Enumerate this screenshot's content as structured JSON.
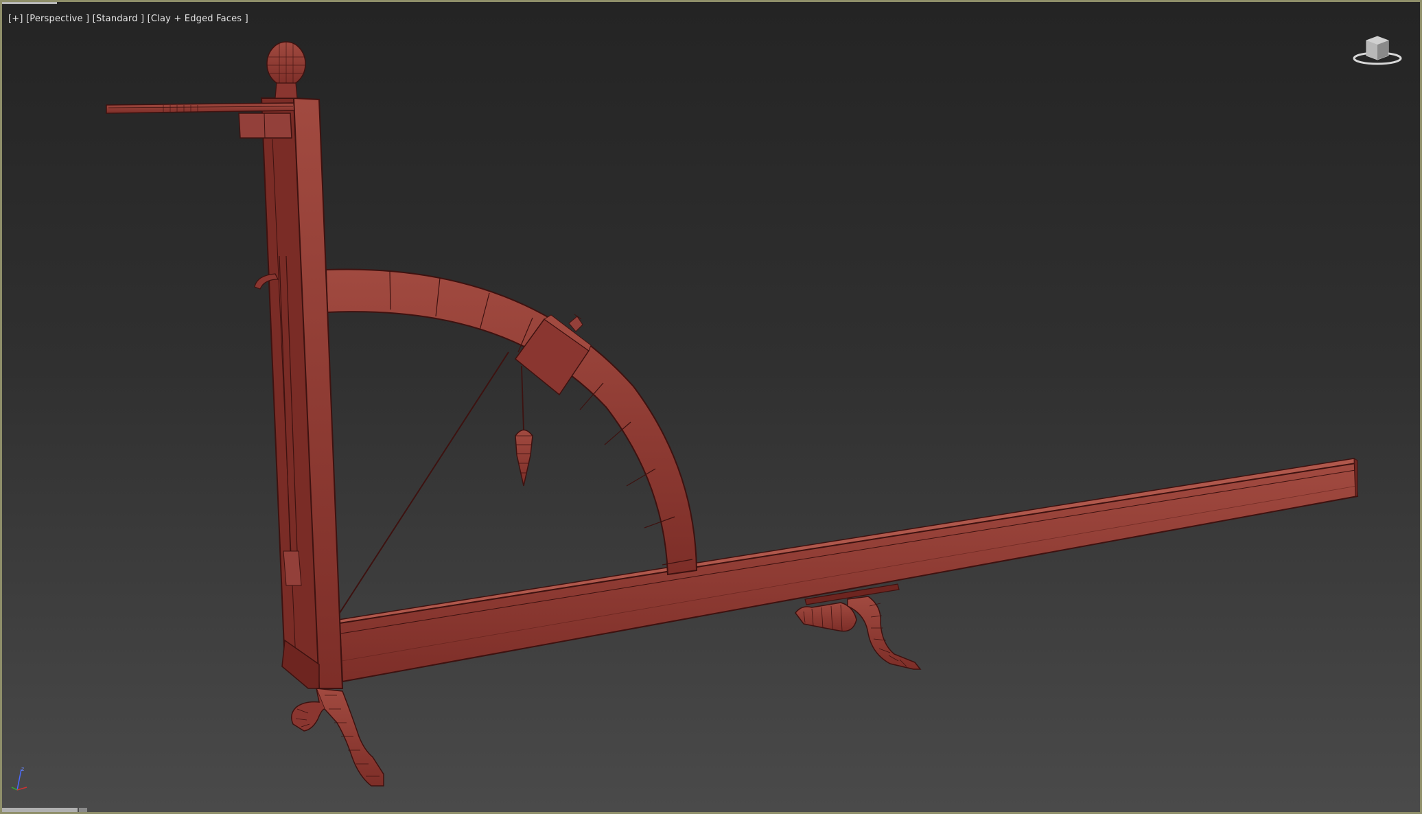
{
  "viewport": {
    "label": "[+] [Perspective ] [Standard ] [Clay + Edged Faces ]",
    "border_color": "#8f8f6a",
    "model_color": "#8e3a32",
    "model_edge_color": "#3d1210"
  },
  "viewcube": {
    "icon": "viewcube-icon"
  },
  "axis_tripod": {
    "icon": "axis-tripod-icon"
  }
}
